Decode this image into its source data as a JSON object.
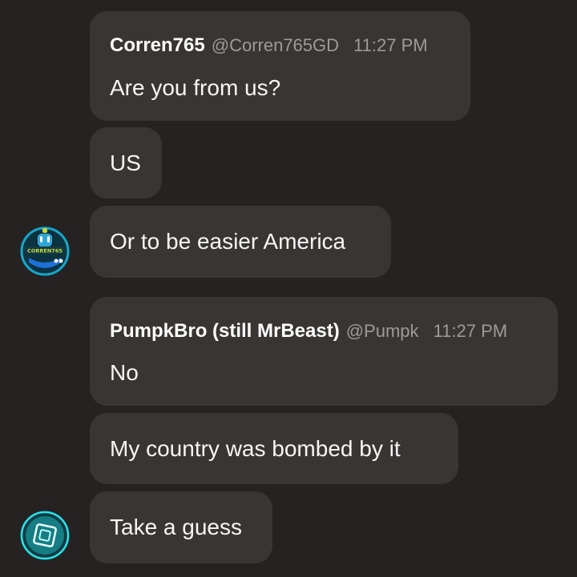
{
  "messages": {
    "group1": {
      "username": "Corren765",
      "handle": "@Corren765GD",
      "time": "11:27 PM",
      "lines": [
        "Are you from us?",
        "US",
        "Or to be easier America"
      ],
      "avatar": {
        "icon": "corren765-avatar-icon",
        "text": "CORREN765"
      }
    },
    "group2": {
      "username": "PumpkBro (still MrBeast)",
      "handle": "@Pumpk",
      "time": "11:27 PM",
      "lines": [
        "No",
        "My country was bombed by it",
        "Take a guess"
      ],
      "avatar": {
        "icon": "cyan-block-avatar-icon"
      }
    }
  },
  "colors": {
    "background": "#252221",
    "bubble": "#393533",
    "secondary_text": "#9f9a97"
  }
}
